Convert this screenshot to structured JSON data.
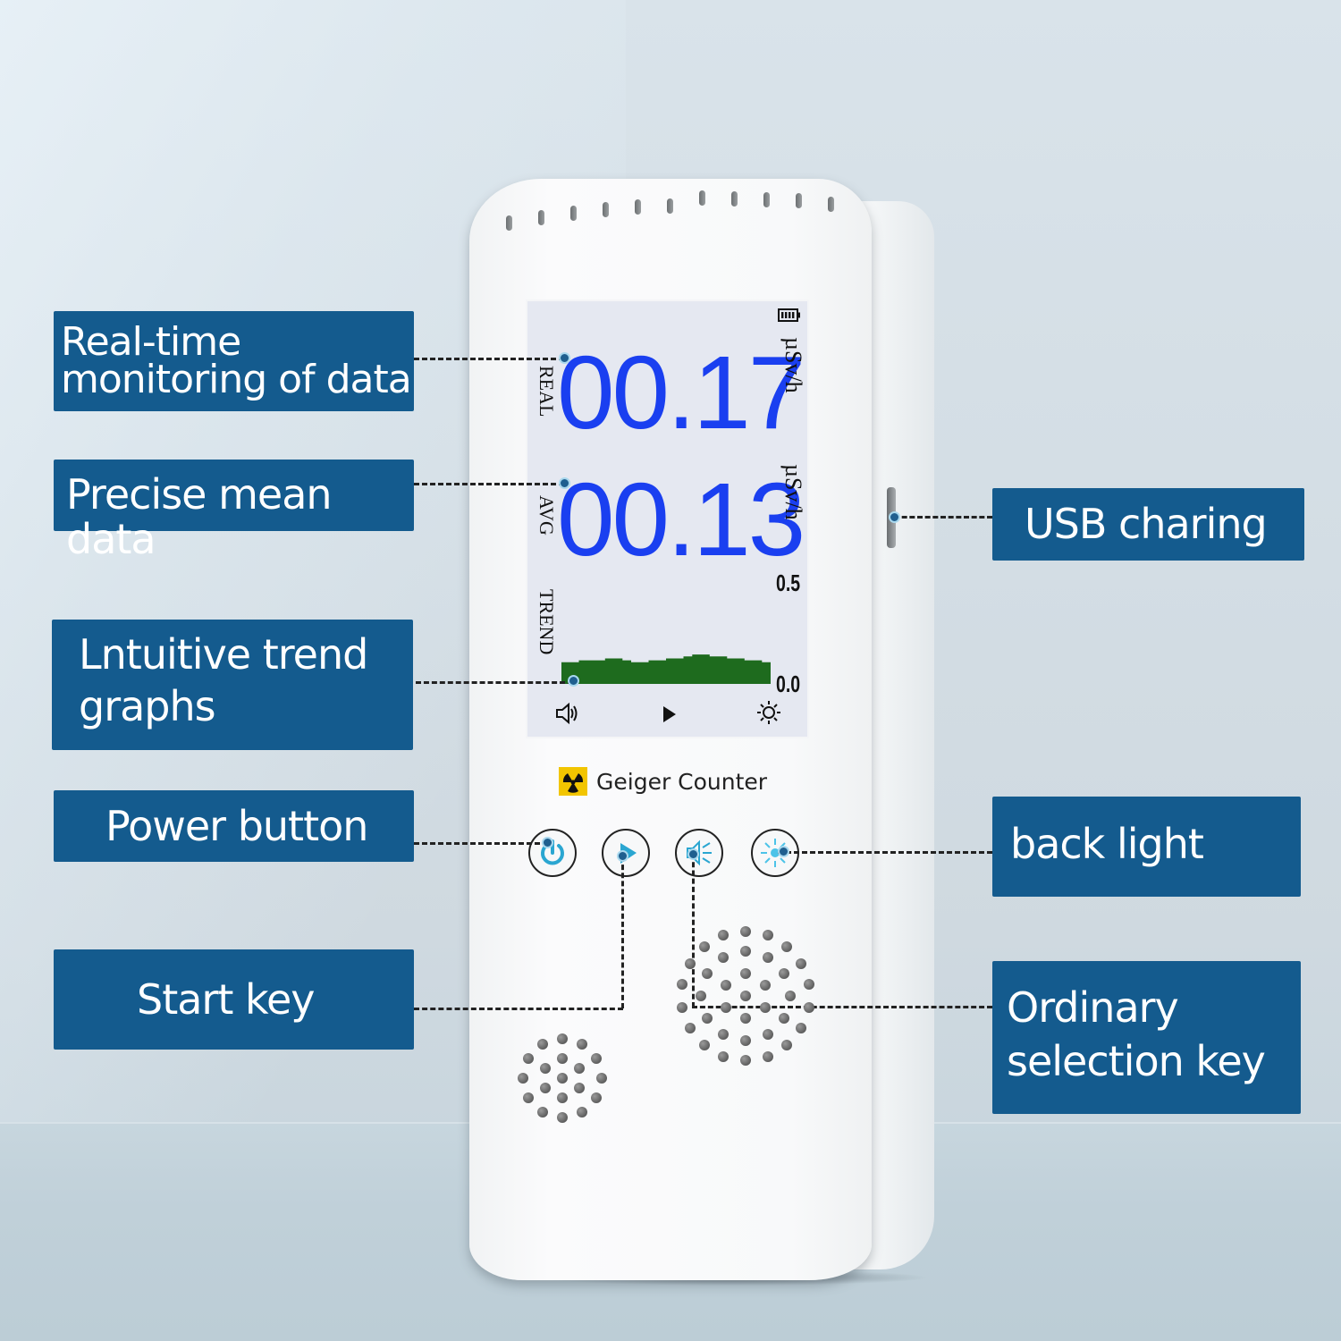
{
  "product": {
    "brand_label": "Geiger Counter",
    "brand_icon": "radiation-icon"
  },
  "screen": {
    "battery_icon": "battery-full-icon",
    "real": {
      "label": "REAL",
      "value": "00.17",
      "unit": "µSv/h"
    },
    "avg": {
      "label": "AVG",
      "value": "00.13",
      "unit": "µSv/h"
    },
    "trend": {
      "label": "TREND",
      "scale_max": "0.5",
      "scale_min": "0.0",
      "values": [
        0.11,
        0.11,
        0.12,
        0.12,
        0.12,
        0.13,
        0.13,
        0.12,
        0.11,
        0.11,
        0.12,
        0.12,
        0.13,
        0.13,
        0.14,
        0.15,
        0.15,
        0.14,
        0.14,
        0.13,
        0.13,
        0.12,
        0.12,
        0.11
      ]
    },
    "status_icons": [
      "speaker-icon",
      "play-icon",
      "sun-icon"
    ]
  },
  "buttons": [
    {
      "name": "power",
      "icon": "power-icon"
    },
    {
      "name": "start",
      "icon": "play-icon"
    },
    {
      "name": "sound",
      "icon": "speaker-icon"
    },
    {
      "name": "backlight",
      "icon": "backlight-icon"
    }
  ],
  "callouts": {
    "realtime": [
      "Real-time",
      "monitoring of data"
    ],
    "mean": "Precise mean data",
    "trend": [
      "Lntuitive trend",
      "graphs"
    ],
    "power": "Power button",
    "start": "Start key",
    "usb": "USB charing",
    "backlight": "back light",
    "select": [
      "Ordinary",
      "selection key"
    ]
  },
  "colors": {
    "callout_bg": "#145b8e",
    "reading": "#1a3ff0",
    "trend_fill": "#1e6b1e",
    "accent_icon": "#2aa6d1",
    "radiation_badge": "#f2c500"
  }
}
